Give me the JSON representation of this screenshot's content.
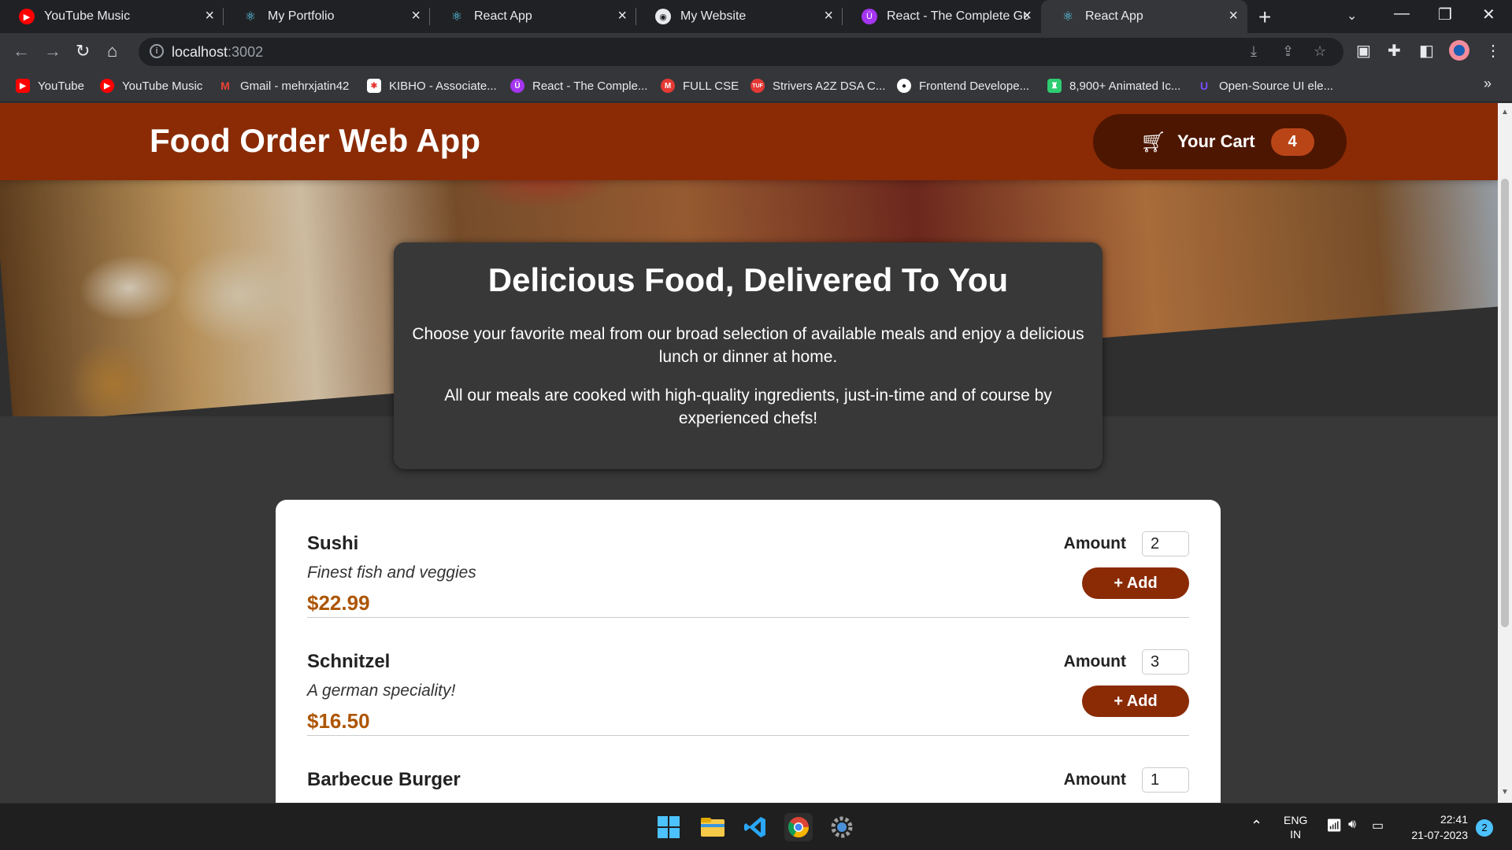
{
  "browser": {
    "tabs": [
      {
        "label": "YouTube Music",
        "icon": "youtube-music-icon",
        "color": "#ff0000"
      },
      {
        "label": "My Portfolio",
        "icon": "react-icon",
        "color": "#61dafb"
      },
      {
        "label": "React App",
        "icon": "react-icon",
        "color": "#61dafb"
      },
      {
        "label": "My Website",
        "icon": "globe-icon",
        "color": "#e8eaed"
      },
      {
        "label": "React - The Complete Guid",
        "icon": "udemy-icon",
        "color": "#a435f0"
      },
      {
        "label": "React App",
        "icon": "react-icon",
        "color": "#61dafb",
        "active": true
      }
    ],
    "url_host": "localhost",
    "url_port": ":3002",
    "bookmarks": [
      {
        "label": "YouTube",
        "icon": "youtube-icon",
        "color": "#ff0000"
      },
      {
        "label": "YouTube Music",
        "icon": "youtube-music-icon",
        "color": "#ff0000"
      },
      {
        "label": "Gmail - mehrxjatin42",
        "icon": "gmail-icon",
        "color": "#ea4335"
      },
      {
        "label": "KIBHO - Associate...",
        "icon": "kibho-icon",
        "color": "#4caf50"
      },
      {
        "label": "React - The Comple...",
        "icon": "udemy-icon",
        "color": "#a435f0"
      },
      {
        "label": "FULL CSE",
        "icon": "m-icon",
        "color": "#e53935"
      },
      {
        "label": "Strivers A2Z DSA C...",
        "icon": "tuf-icon",
        "color": "#e53935"
      },
      {
        "label": "Frontend Develope...",
        "icon": "github-icon",
        "color": "#ffffff"
      },
      {
        "label": "8,900+ Animated Ic...",
        "icon": "animated-icons-icon",
        "color": "#2ecc71"
      },
      {
        "label": "Open-Source UI ele...",
        "icon": "uiverse-icon",
        "color": "#7c4dff"
      }
    ]
  },
  "app": {
    "title": "Food Order Web App",
    "cart_label": "Your Cart",
    "cart_count": "4",
    "summary": {
      "heading": "Delicious Food, Delivered To You",
      "para1": "Choose your favorite meal from our broad selection of available meals and enjoy a delicious lunch or dinner at home.",
      "para2": "All our meals are cooked with high-quality ingredients, just-in-time and of course by experienced chefs!"
    },
    "amount_label": "Amount",
    "add_label": "+ Add",
    "meals": [
      {
        "name": "Sushi",
        "description": "Finest fish and veggies",
        "price": "$22.99",
        "amount": "2"
      },
      {
        "name": "Schnitzel",
        "description": "A german speciality!",
        "price": "$16.50",
        "amount": "3"
      },
      {
        "name": "Barbecue Burger",
        "description": "",
        "price": "",
        "amount": "1"
      }
    ],
    "colors": {
      "header": "#8a2b06",
      "cart_button": "#4d1601",
      "badge": "#b94517",
      "price": "#ad5502",
      "background": "#383838"
    }
  },
  "taskbar": {
    "lang_top": "ENG",
    "lang_bottom": "IN",
    "time": "22:41",
    "date": "21-07-2023",
    "notifications": "2"
  }
}
